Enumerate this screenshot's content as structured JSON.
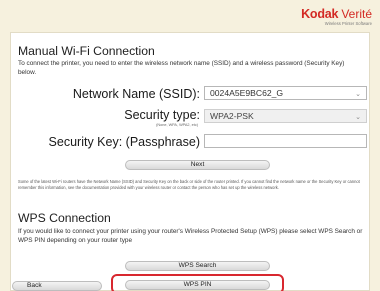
{
  "brand": {
    "name": "Kodak",
    "product": "Verité",
    "tagline": "Wireless Printer Software"
  },
  "manual": {
    "title": "Manual Wi-Fi Connection",
    "description": "To connect the printer, you need to enter the wireless network name (SSID) and a wireless password (Security Key) below.",
    "network_label": "Network Name (SSID):",
    "network_value": "0024A5E9BC62_G",
    "security_label": "Security type:",
    "security_sub": "(None, WPA, WPA2, etc)",
    "security_value": "WPA2-PSK",
    "key_label": "Security Key: (Passphrase)",
    "key_value": "",
    "next_label": "Next",
    "note": "Some of the latest Wi-Fi routers have the Network Name (SSID) and Security Key on the back or side of the router printed. If you cannot find the network name or the Security Key or cannot remember this information, see the documentation provided with your wireless router or contact the person who has set up the wireless network."
  },
  "wps": {
    "title": "WPS Connection",
    "description": "If you would like to connect your printer using your router's Wireless Protected Setup (WPS) please select WPS Search or WPS PIN depending on your router type",
    "search_label": "WPS Search",
    "pin_label": "WPS PIN"
  },
  "footer": {
    "back_label": "Back"
  },
  "colors": {
    "accent": "#d32a24",
    "highlight": "#d8272f",
    "background": "#f6f1de"
  }
}
